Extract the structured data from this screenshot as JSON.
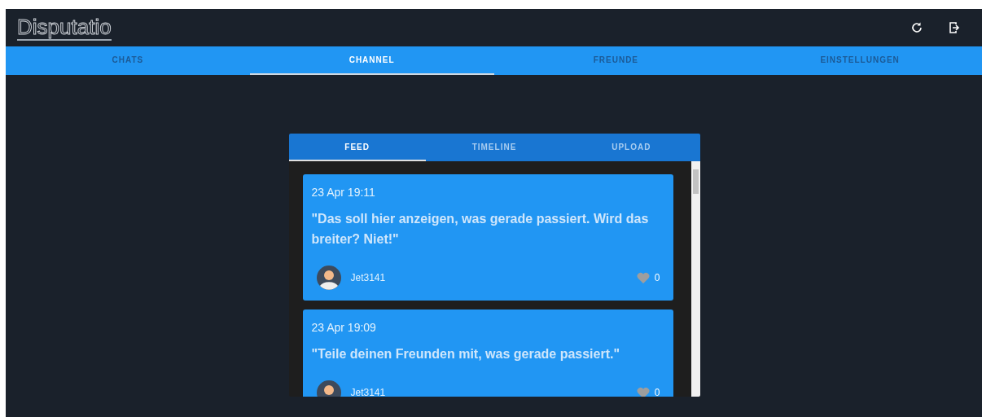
{
  "app": {
    "logo": "Disputatio"
  },
  "main_tabs": [
    {
      "label": "CHATS",
      "selected": false
    },
    {
      "label": "CHANNEL",
      "selected": true
    },
    {
      "label": "FREUNDE",
      "selected": false
    },
    {
      "label": "EINSTELLUNGEN",
      "selected": false
    }
  ],
  "channel_tabs": [
    {
      "label": "FEED",
      "selected": true
    },
    {
      "label": "TIMELINE",
      "selected": false
    },
    {
      "label": "UPLOAD",
      "selected": false
    }
  ],
  "posts": [
    {
      "time": "23 Apr 19:11",
      "text": "\"Das soll hier anzeigen, was gerade passiert. Wird das breiter? Niet!\"",
      "author": "Jet3141",
      "likes": "0"
    },
    {
      "time": "23 Apr 19:09",
      "text": "\"Teile deinen Freunden mit, was gerade passiert.\"",
      "author": "Jet3141",
      "likes": "0"
    }
  ]
}
